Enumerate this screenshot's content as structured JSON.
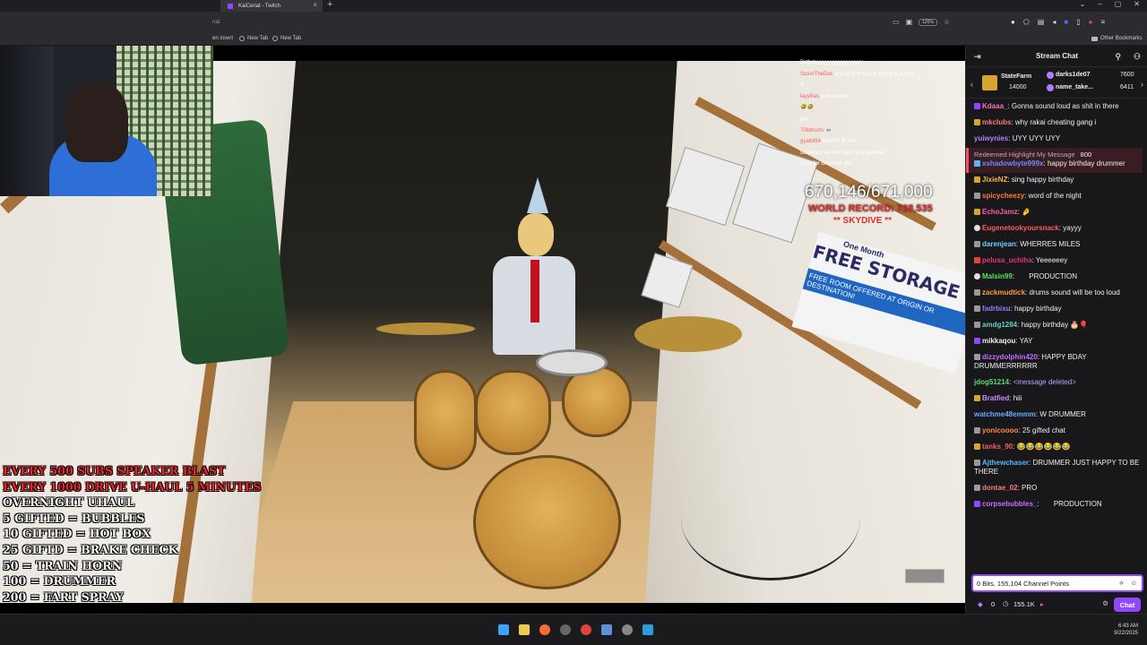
{
  "browser": {
    "tab_title": "KaiCenat - Twitch",
    "new_tab_symbol": "+",
    "url_fragment": "nat",
    "zoom": "120%",
    "bookmarks": [
      "en invert",
      "New Tab",
      "New Tab"
    ],
    "other_bookmarks": "Other Bookmarks"
  },
  "stream": {
    "overlay_chat": [
      {
        "name": "",
        "msg": "Birthdayyyyyyyyyyyyyyyyy"
      },
      {
        "name": "ScourTheDoc",
        "msg": "w w w w w w w w w w w w w w w"
      },
      {
        "name": "",
        "msg": "w"
      },
      {
        "name": "layylilas",
        "msg": "w drummer"
      },
      {
        "name": "",
        "msg": "🤣🤣"
      },
      {
        "name": "",
        "msg": "yay"
      },
      {
        "name": "708drums",
        "msg": "💀"
      },
      {
        "name": "gyatt454",
        "msg": "HAPPY B DAY"
      },
      {
        "name": "",
        "msg": "surprised we aint seen any birthday"
      },
      {
        "name": "",
        "msg": "100x for drummer yet"
      }
    ],
    "sub_count": "670,146/671,000",
    "world_record": "WORLD RECORD: 728,535",
    "skydive": "** SKYDIVE **",
    "rules_red": [
      "EVERY 500 SUBS SPEAKER BLAST",
      "EVERY 1000 DRIVE U-HAUL 5 MINUTES"
    ],
    "rules_white": [
      "OVERNIGHT UHAUL",
      "5 GIFTED = BUBBLES",
      "10 GIFTED = HOT BOX",
      "25 GIFTD = BRAKE CHECK",
      "50 = TRAIN HORN",
      "100 = DRUMMER",
      "200 = FART SPRAY"
    ],
    "sign_lines": [
      "One Month",
      "FREE STORAGE",
      "FREE ROOM OFFERED AT ORIGIN OR DESTINATION!"
    ]
  },
  "chat": {
    "header": "Stream Chat",
    "leaderboard": [
      {
        "name": "StateFarm",
        "value": "14000"
      },
      {
        "name": "darks1de07",
        "value": "7600"
      },
      {
        "name": "name_take...",
        "value": "6411"
      }
    ],
    "messages": [
      {
        "user": "Kdaaa_",
        "color": "#ff6ec7",
        "text": "Gonna sound loud as shit in there",
        "badge": "#9147ff"
      },
      {
        "user": "mkclubs",
        "color": "#ff7a7a",
        "text": "why rakai cheating gang i",
        "badge": "#d4a630"
      },
      {
        "user": "yuiwynies",
        "color": "#b57cff",
        "text": "UYY UYY UYY",
        "badge": ""
      },
      {
        "user": "xshadowbyte999x",
        "color": "#6a8cff",
        "text": "happy birthday drummer",
        "badge": "#56b5f5",
        "highlight": true,
        "hl_label": "Redeemed Highlight My Message",
        "hl_cost": "800"
      },
      {
        "user": "JixieNZ",
        "color": "#ffb347",
        "text": "sing happy birthday",
        "badge": "#d4a630"
      },
      {
        "user": "spicycheezy",
        "color": "#ff7a3d",
        "text": "word of the night",
        "badge": "#999"
      },
      {
        "user": "EchoJamz",
        "color": "#ff5fa2",
        "text": "🤌",
        "badge": "#d4a630"
      },
      {
        "user": "Eugenetookyoursnack",
        "color": "#ff5c5c",
        "text": "yayyy",
        "badge": "#e0e0e0"
      },
      {
        "user": "darenjean",
        "color": "#6ad0ff",
        "text": "WHERRES MILES",
        "badge": "#999"
      },
      {
        "user": "pelusa_uchiha",
        "color": "#e6337a",
        "text": "Yeeeeeey",
        "badge": "#e0443a"
      },
      {
        "user": "Malsin99",
        "color": "#5be05b",
        "text": "PRODUCTION",
        "badge": "#e0e0e0"
      },
      {
        "user": "zackmudtick",
        "color": "#ff9a3d",
        "text": "drums sound will be too loud",
        "badge": "#999"
      },
      {
        "user": "fadrbixu",
        "color": "#9b7bff",
        "text": "happy birthday",
        "badge": "#999"
      },
      {
        "user": "amdg1284",
        "color": "#5fd3c0",
        "text": "happy birthday 🎂🎈",
        "badge": "#999"
      },
      {
        "user": "mikkaqou",
        "color": "#efeff1",
        "text": "YAY",
        "badge": "#9147ff"
      },
      {
        "user": "dizzydolphin420",
        "color": "#c86bff",
        "text": "HAPPY BDAY DRUMMERRRRRR",
        "badge": "#999"
      },
      {
        "user": "jdog51214",
        "color": "#5bd97a",
        "text": "<message deleted>",
        "badge": "",
        "deleted": true
      },
      {
        "user": "Bratfied",
        "color": "#c88bff",
        "text": "hiii",
        "badge": "#d4a630"
      },
      {
        "user": "watchme48emmm",
        "color": "#6aa8ff",
        "text": "W DRUMMER",
        "badge": ""
      },
      {
        "user": "yonicoooo",
        "color": "#ff8a3d",
        "text": "25 gifted chat",
        "badge": "#999"
      },
      {
        "user": "tanks_90",
        "color": "#ff5c5c",
        "text": "😂😂😂😂😂😂",
        "badge": "#d4a630"
      },
      {
        "user": "Ajthewchaser",
        "color": "#5fb5ff",
        "text": "DRUMMER JUST HAPPY TO BE THERE",
        "badge": "#999"
      },
      {
        "user": "dontae_02",
        "color": "#ff7a7a",
        "text": "PRO",
        "badge": "#999"
      },
      {
        "user": "corpsebubbles_",
        "color": "#c86bff",
        "text": "PRODUCTION",
        "badge": "#9147ff"
      }
    ],
    "input_text": "0 Bits, 155,104 Channel Points",
    "bits": "0",
    "points": "155.1K",
    "chat_button": "Chat"
  },
  "taskbar": {
    "time": "6:43 AM",
    "date": "9/22/2025"
  }
}
